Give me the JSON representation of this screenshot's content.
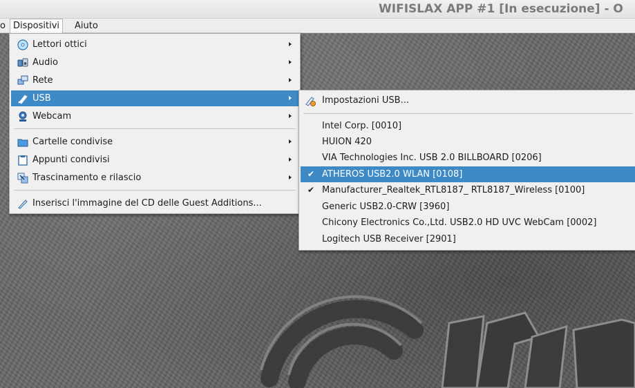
{
  "window": {
    "title": "WIFISLAX APP #1 [In esecuzione] - O"
  },
  "menubar": {
    "items": [
      "o",
      "Dispositivi",
      "Aiuto"
    ]
  },
  "devices_menu": {
    "items": [
      {
        "label": "Lettori ottici",
        "icon": "optical-disc-icon",
        "submenu": true
      },
      {
        "label": "Audio",
        "icon": "audio-icon",
        "submenu": true
      },
      {
        "label": "Rete",
        "icon": "network-icon",
        "submenu": true
      },
      {
        "label": "USB",
        "icon": "usb-icon",
        "submenu": true,
        "highlighted": true
      },
      {
        "label": "Webcam",
        "icon": "webcam-icon",
        "submenu": true
      },
      {
        "label": "Cartelle condivise",
        "icon": "folder-icon",
        "submenu": true
      },
      {
        "label": "Appunti condivisi",
        "icon": "clipboard-icon",
        "submenu": true
      },
      {
        "label": "Trascinamento e rilascio",
        "icon": "drag-drop-icon",
        "submenu": true
      },
      {
        "label": "Inserisci l'immagine del CD delle Guest Additions...",
        "icon": "cd-insert-icon",
        "submenu": false
      }
    ]
  },
  "usb_submenu": {
    "settings_label": "Impostazioni USB...",
    "devices": [
      {
        "label": "Intel Corp.  [0010]",
        "checked": false
      },
      {
        "label": "HUION 420",
        "checked": false
      },
      {
        "label": "VIA Technologies Inc. USB 2.0 BILLBOARD [0206]",
        "checked": false
      },
      {
        "label": "ATHEROS USB2.0 WLAN [0108]",
        "checked": true,
        "highlighted": true
      },
      {
        "label": "Manufacturer_Realtek_RTL8187_ RTL8187_Wireless [0100]",
        "checked": true
      },
      {
        "label": "Generic USB2.0-CRW [3960]",
        "checked": false
      },
      {
        "label": "Chicony Electronics Co.,Ltd. USB2.0 HD UVC WebCam [0002]",
        "checked": false
      },
      {
        "label": "Logitech USB Receiver [2901]",
        "checked": false
      }
    ],
    "check_glyph": "✔"
  },
  "colors": {
    "highlight": "#3d8ac6",
    "menu_bg": "#f0f0f0"
  }
}
